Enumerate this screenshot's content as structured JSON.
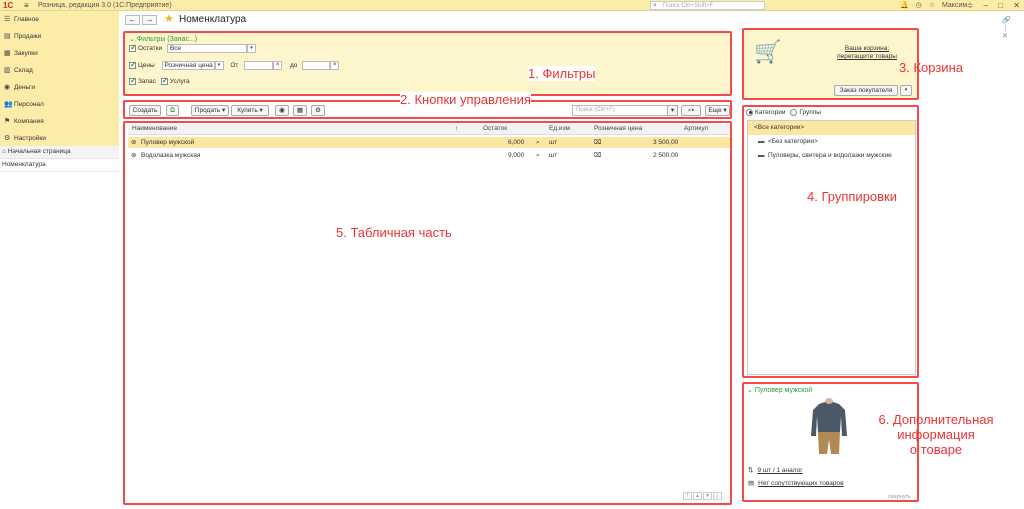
{
  "app": {
    "logo": "1С",
    "title": "Розница, редакция 3.0  (1С:Предприятие)",
    "search_placeholder": "Поиск Ctrl+Shift+F",
    "user": "Максим"
  },
  "sidebar": {
    "items": [
      {
        "label": "Главное",
        "icon": "hamburger-icon"
      },
      {
        "label": "Продажи",
        "icon": "sales-icon"
      },
      {
        "label": "Закупки",
        "icon": "purchases-icon"
      },
      {
        "label": "Склад",
        "icon": "warehouse-icon"
      },
      {
        "label": "Деньги",
        "icon": "money-icon"
      },
      {
        "label": "Персонал",
        "icon": "staff-icon"
      },
      {
        "label": "Компания",
        "icon": "company-icon"
      },
      {
        "label": "Настройки",
        "icon": "settings-icon"
      }
    ],
    "home": "Начальная страница",
    "open_item": "Номенклатура"
  },
  "page": {
    "title": "Номенклатура",
    "back": "←",
    "forward": "→"
  },
  "filters": {
    "header": "Фильтры (Запас...)",
    "stock_label": "Остатки",
    "stock_value": "Все",
    "prices_label": "Цены",
    "price_type": "Розничная цена",
    "from_label": "От",
    "to_label": "до",
    "stock_kind_label": "Запас",
    "service_label": "Услуга",
    "stock_checked": true,
    "prices_checked": true,
    "stock_kind_checked": true,
    "service_checked": true
  },
  "commands": {
    "create": "Создать",
    "sell": "Продать ▾",
    "buy": "Купить ▾",
    "search_placeholder": "Поиск (Ctrl+F)",
    "more": "Еще ▾"
  },
  "table": {
    "headers": [
      "Наименование",
      "Остаток",
      "Ед.изм",
      "Розничная цена",
      "Артикул"
    ],
    "rows": [
      {
        "name": "Пуловер мужской",
        "stock": "6,000",
        "unit": "шт",
        "price": "3 500,00",
        "article": ""
      },
      {
        "name": "Водолазка мужская",
        "stock": "9,000",
        "unit": "шт",
        "price": "2 500,00",
        "article": ""
      }
    ]
  },
  "cart": {
    "text_line1": "Ваша корзина:",
    "text_line2": "перетащите товары",
    "order_button": "Заказ покупателя"
  },
  "groups": {
    "radio_categories": "Категории",
    "radio_groups": "Группы",
    "items": [
      "<Все категории>",
      "<Без категории>",
      "Пуловеры, свитера и водолазки мужские"
    ]
  },
  "product_info": {
    "title": "Пуловер мужской",
    "stock_link": "9 шт / 1 аналог",
    "related_link": "Нет сопутствующих товаров",
    "collapse": "свернуть"
  },
  "annotations": {
    "filters": "1. Фильтры",
    "buttons": "2. Кнопки управления",
    "cart": "3. Корзина",
    "groups": "4. Группировки",
    "table": "5. Табличная часть",
    "info_line1": "6. Дополнительная",
    "info_line2": "информация",
    "info_line3": "о товаре"
  },
  "colors": {
    "accent_yellow": "#fbeda8",
    "panel_yellow": "#fdf6cc",
    "selection": "#fbe6a2",
    "annotation_red": "#f24b4b",
    "link_green": "#2c9c3b"
  }
}
